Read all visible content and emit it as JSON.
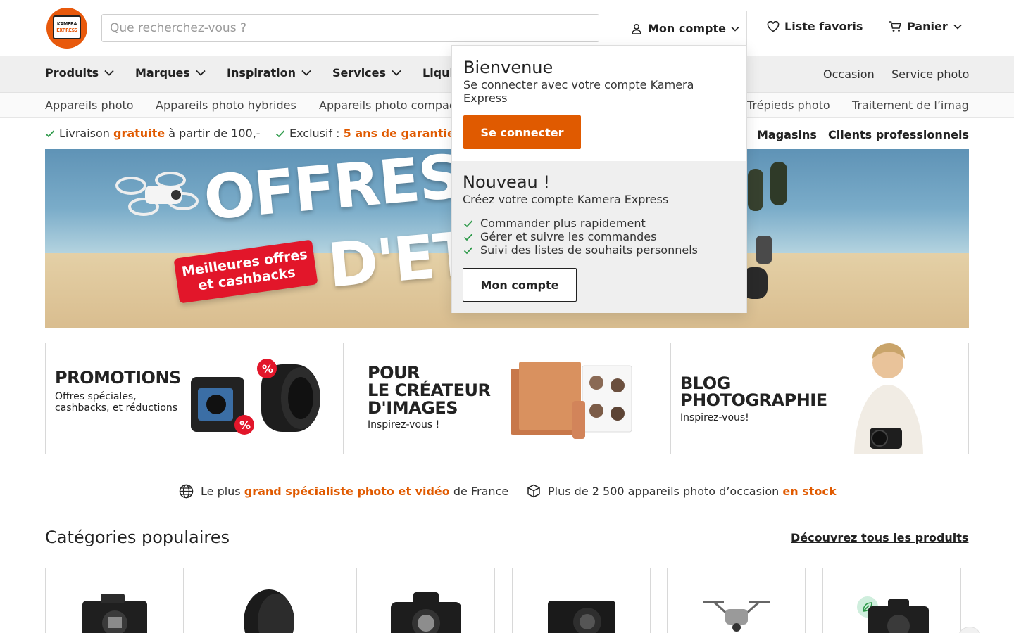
{
  "brand": {
    "logo_line1": "KAMERA",
    "logo_line2": "EXPRESS",
    "accent": "#e05a00"
  },
  "header": {
    "search_placeholder": "Que recherchez-vous ?",
    "account": {
      "label": "Mon compte",
      "icon": "user-icon"
    },
    "favorites": {
      "label": "Liste favoris",
      "icon": "heart-icon"
    },
    "cart": {
      "label": "Panier",
      "icon": "cart-icon"
    }
  },
  "main_nav": {
    "items": [
      {
        "label": "Produits"
      },
      {
        "label": "Marques"
      },
      {
        "label": "Inspiration"
      },
      {
        "label": "Services"
      },
      {
        "label": "Liqui"
      }
    ],
    "right": [
      "Occasion",
      "Service photo"
    ]
  },
  "sub_nav": [
    "Appareils photo",
    "Appareils photo hybrides",
    "Appareils photo compac",
    "Trépieds photo",
    "Traitement de l’imag"
  ],
  "usp": {
    "delivery_pre": "Livraison",
    "delivery_hl": "gratuite",
    "delivery_post": "à partir de 100,-",
    "exclusive_pre": "Exclusif :",
    "exclusive_hl": "5 ans de garantie",
    "stores": "Magasins",
    "pro": "Clients professionnels"
  },
  "hero": {
    "title_line1": "OFFRES",
    "title_line2": "D'ET",
    "badge_line1": "Meilleures offres",
    "badge_line2": "et cashbacks"
  },
  "account_dropdown": {
    "welcome_title": "Bienvenue",
    "welcome_text": "Se connecter avec votre compte Kamera Express",
    "login_button": "Se connecter",
    "new_title": "Nouveau !",
    "new_text": "Créez votre compte Kamera Express",
    "benefits": [
      "Commander plus rapidement",
      "Gérer et suivre les commandes",
      "Suivi des listes de souhaits personnels"
    ],
    "account_button": "Mon compte"
  },
  "promo_cards": [
    {
      "title_lines": [
        "PROMOTIONS"
      ],
      "subtitle_lines": [
        "Offres spéciales,",
        "cashbacks, et réductions"
      ]
    },
    {
      "title_lines": [
        "POUR",
        "LE CRÉATEUR",
        "D'IMAGES"
      ],
      "subtitle_lines": [
        "Inspirez-vous !"
      ]
    },
    {
      "title_lines": [
        "BLOG",
        "PHOTOGRAPHIE"
      ],
      "subtitle_lines": [
        "Inspirez-vous!"
      ]
    }
  ],
  "info_strip": {
    "a_pre": "Le plus",
    "a_hl": "grand spécialiste photo et vidéo",
    "a_post": "de France",
    "b_pre": "Plus de 2 500 appareils photo d’occasion",
    "b_hl": "en stock"
  },
  "categories": {
    "title": "Catégories populaires",
    "link": "Découvrez tous les produits",
    "items": [
      {
        "icon": "mirrorless-camera-icon"
      },
      {
        "icon": "lens-icon"
      },
      {
        "icon": "dslr-camera-icon"
      },
      {
        "icon": "compact-camera-icon"
      },
      {
        "icon": "drone-icon"
      },
      {
        "icon": "refurbished-camera-icon"
      }
    ]
  }
}
